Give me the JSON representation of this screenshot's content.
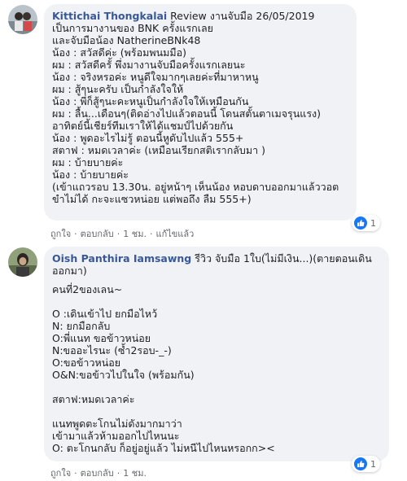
{
  "comments": [
    {
      "author": "Kittichai Thongkalai",
      "lines": [
        " Review งานจับมือ 26/05/2019",
        "เป็นการมางานของ BNK ครั้งแรกเลย",
        "และจับมือน้อง NatherineBNk48",
        "น้อง : สวัสดีค่ะ (พร้อมพนมมือ)",
        "ผม : สวัสดีครั้ พึ่งมางานจับมือครั้งแรกเลยนะ",
        "น้อง : จริงหรอค่ะ หนูดีใจมากๆเลยค่ะที่มาหาหนู",
        "ผม : สู้ๆนะครับ เป็นกำลังใจให้",
        "น้อง : พี่ก็สู้ๆนะคะหนูเป็นกำลังใจให้เหมือนกัน",
        "ผม : ลื้น...เดือนๆ(ติดอ่างไปแล้วตอนนี้ โดนสตั้นตาเมจรุนแรง)",
        "อาทิตย์นี้เชียร์ทีมเราให้ได้แชมป์ไปด้วยกัน",
        "น้อง : พูดอะไรไม่รู้ ตอนนี้หูดับไปแล้ว 555+",
        "สตาฟ : หมดเวลาค่ะ (เหมือนเรียกสติเรากลับมา )",
        "ผม : บ้ายบายค่ะ",
        "น้อง : บ้ายบายค่ะ",
        "(เข้าแถวรอบ 13.30น. อยู่หน้าๆ เห็นน้อง หอบดาบออกมาแล้ววอต",
        "ขำไม่ได้ กะจะแซวหน่อย แต่พอถึง ลืม 555+)"
      ],
      "reaction_count": "1",
      "actions": [
        "ถูกใจ",
        "ตอบกลับ",
        "1 ชม.",
        "แก้ไขแล้ว"
      ]
    },
    {
      "author": "Oish Panthira Iamsawng",
      "first_text": " รีวิว จับมือ 1ใบ(ไม่มีเงิน...)(ตายตอนเดินออกมา)",
      "lines": [
        "คนที่2ของเลน~",
        "",
        "O :เดินเข้าไป ยกมือไหว้",
        "N: ยกมือกลับ",
        "O:พี่แนท ขอข้าวหน่อย",
        "N:ขออะไรนะ (ซ้ำ2รอบ-_-)",
        "O:ขอข้าวหน่อย",
        "O&N:ขอข้าวไปในใจ (พร้อมกัน)",
        "",
        "สตาฟ:หมดเวลาค่ะ",
        "",
        "แนทพูดตะโกนไม่ดังมากมาว่า",
        "เข้ามาแล้วห้ามออกไปไหนนะ",
        "O: ตะโกนกลับ ก็อยู่อยู่แล้ว ไม่หนีไปไหนหรอกก><"
      ],
      "reaction_count": "1",
      "actions": [
        "ถูกใจ",
        "ตอบกลับ",
        "1 ชม."
      ]
    }
  ]
}
